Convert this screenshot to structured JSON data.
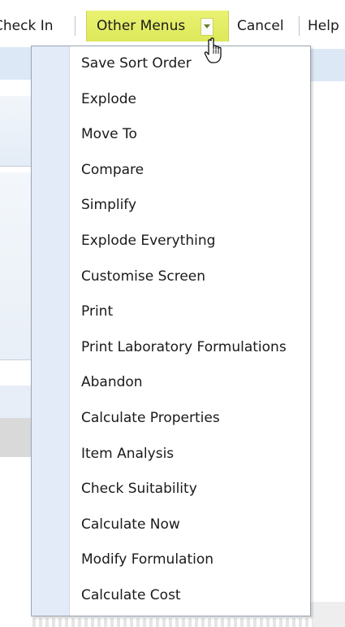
{
  "toolbar": {
    "check_in_label": "Check In",
    "other_menus_label": "Other Menus",
    "cancel_label": "Cancel",
    "help_label": "Help",
    "highlight_color": "#e3ec63"
  },
  "menu": {
    "items": [
      {
        "label": "Save Sort Order"
      },
      {
        "label": "Explode"
      },
      {
        "label": "Move To"
      },
      {
        "label": "Compare"
      },
      {
        "label": "Simplify"
      },
      {
        "label": "Explode Everything"
      },
      {
        "label": "Customise Screen"
      },
      {
        "label": "Print"
      },
      {
        "label": "Print Laboratory Formulations"
      },
      {
        "label": "Abandon"
      },
      {
        "label": "Calculate Properties"
      },
      {
        "label": "Item Analysis"
      },
      {
        "label": "Check Suitability"
      },
      {
        "label": "Calculate Now"
      },
      {
        "label": "Modify Formulation"
      },
      {
        "label": "Calculate Cost"
      }
    ]
  },
  "cursor": {
    "icon": "hand-pointer-icon"
  }
}
